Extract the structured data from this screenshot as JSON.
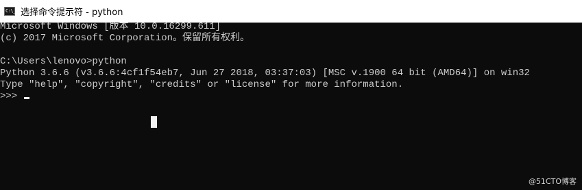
{
  "window": {
    "title": "选择命令提示符 - python",
    "icon_name": "command-prompt-icon",
    "icon_glyph": "C:\\_"
  },
  "console": {
    "lines": [
      "Microsoft Windows [版本 10.0.16299.611]",
      "(c) 2017 Microsoft Corporation。保留所有权利。",
      "",
      "C:\\Users\\lenovo>python",
      "Python 3.6.6 (v3.6.6:4cf1f54eb7, Jun 27 2018, 03:37:03) [MSC v.1900 64 bit (AMD64)] on win32",
      "Type \"help\", \"copyright\", \"credits\" or \"license\" for more information.",
      ">>> "
    ],
    "text_color": "#cccccc",
    "background_color": "#0c0c0c"
  },
  "watermark": {
    "text": "@51CTO博客"
  }
}
